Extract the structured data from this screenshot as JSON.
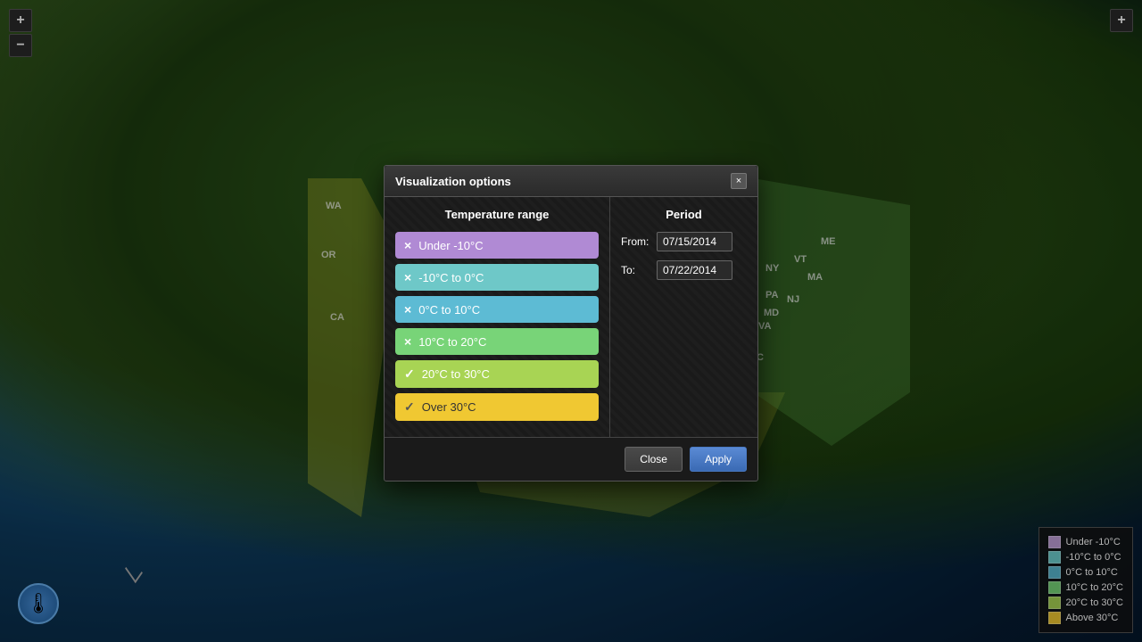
{
  "map": {
    "zoom_in_label": "+",
    "zoom_out_label": "−",
    "top_right_plus": "+",
    "state_labels": [
      {
        "id": "wa",
        "text": "WA",
        "class": "wa-label"
      },
      {
        "id": "or",
        "text": "OR",
        "class": "or-label"
      },
      {
        "id": "ca",
        "text": "CA",
        "class": "ca-label"
      },
      {
        "id": "me",
        "text": "ME",
        "class": "me-label"
      },
      {
        "id": "vt",
        "text": "VT",
        "class": "vt-label"
      },
      {
        "id": "ma",
        "text": "MA",
        "class": "ma-label"
      },
      {
        "id": "ny",
        "text": "NY",
        "class": "ny-label"
      },
      {
        "id": "pa",
        "text": "PA",
        "class": "pa-label"
      },
      {
        "id": "nj",
        "text": "NJ",
        "class": "nj-label"
      },
      {
        "id": "md",
        "text": "MD",
        "class": "md-label"
      },
      {
        "id": "va",
        "text": "VA",
        "class": "va-label"
      },
      {
        "id": "nc",
        "text": "NC",
        "class": "nc-label"
      }
    ]
  },
  "dialog": {
    "title": "Visualization options",
    "close_btn_label": "×",
    "left_panel": {
      "header": "Temperature range",
      "ranges": [
        {
          "id": "under-10",
          "label": "Under -10°C",
          "checked": false,
          "icon": "×",
          "class": "btn-under-10"
        },
        {
          "id": "minus10-0",
          "label": "-10°C to 0°C",
          "checked": false,
          "icon": "×",
          "class": "btn-minus10-0"
        },
        {
          "id": "0-10",
          "label": "0°C to 10°C",
          "checked": false,
          "icon": "×",
          "class": "btn-0-10"
        },
        {
          "id": "10-20",
          "label": "10°C to 20°C",
          "checked": false,
          "icon": "×",
          "class": "btn-10-20"
        },
        {
          "id": "20-30",
          "label": "20°C to 30°C",
          "checked": true,
          "icon": "✓",
          "class": "btn-20-30"
        },
        {
          "id": "over30",
          "label": "Over 30°C",
          "checked": true,
          "icon": "✓",
          "class": "btn-over30"
        }
      ]
    },
    "right_panel": {
      "header": "Period",
      "from_label": "From:",
      "from_value": "07/15/2014",
      "to_label": "To:",
      "to_value": "07/22/2014"
    },
    "footer": {
      "close_label": "Close",
      "apply_label": "Apply"
    }
  },
  "legend": {
    "items": [
      {
        "label": "Under -10°C",
        "color": "#c0a0d8"
      },
      {
        "label": "-10°C to 0°C",
        "color": "#6ecece"
      },
      {
        "label": "0°C to 10°C",
        "color": "#5ab8d0"
      },
      {
        "label": "10°C to 20°C",
        "color": "#78d478"
      },
      {
        "label": "20°C to 30°C",
        "color": "#a8d454"
      },
      {
        "label": "Above 30°C",
        "color": "#f0c832"
      }
    ]
  }
}
